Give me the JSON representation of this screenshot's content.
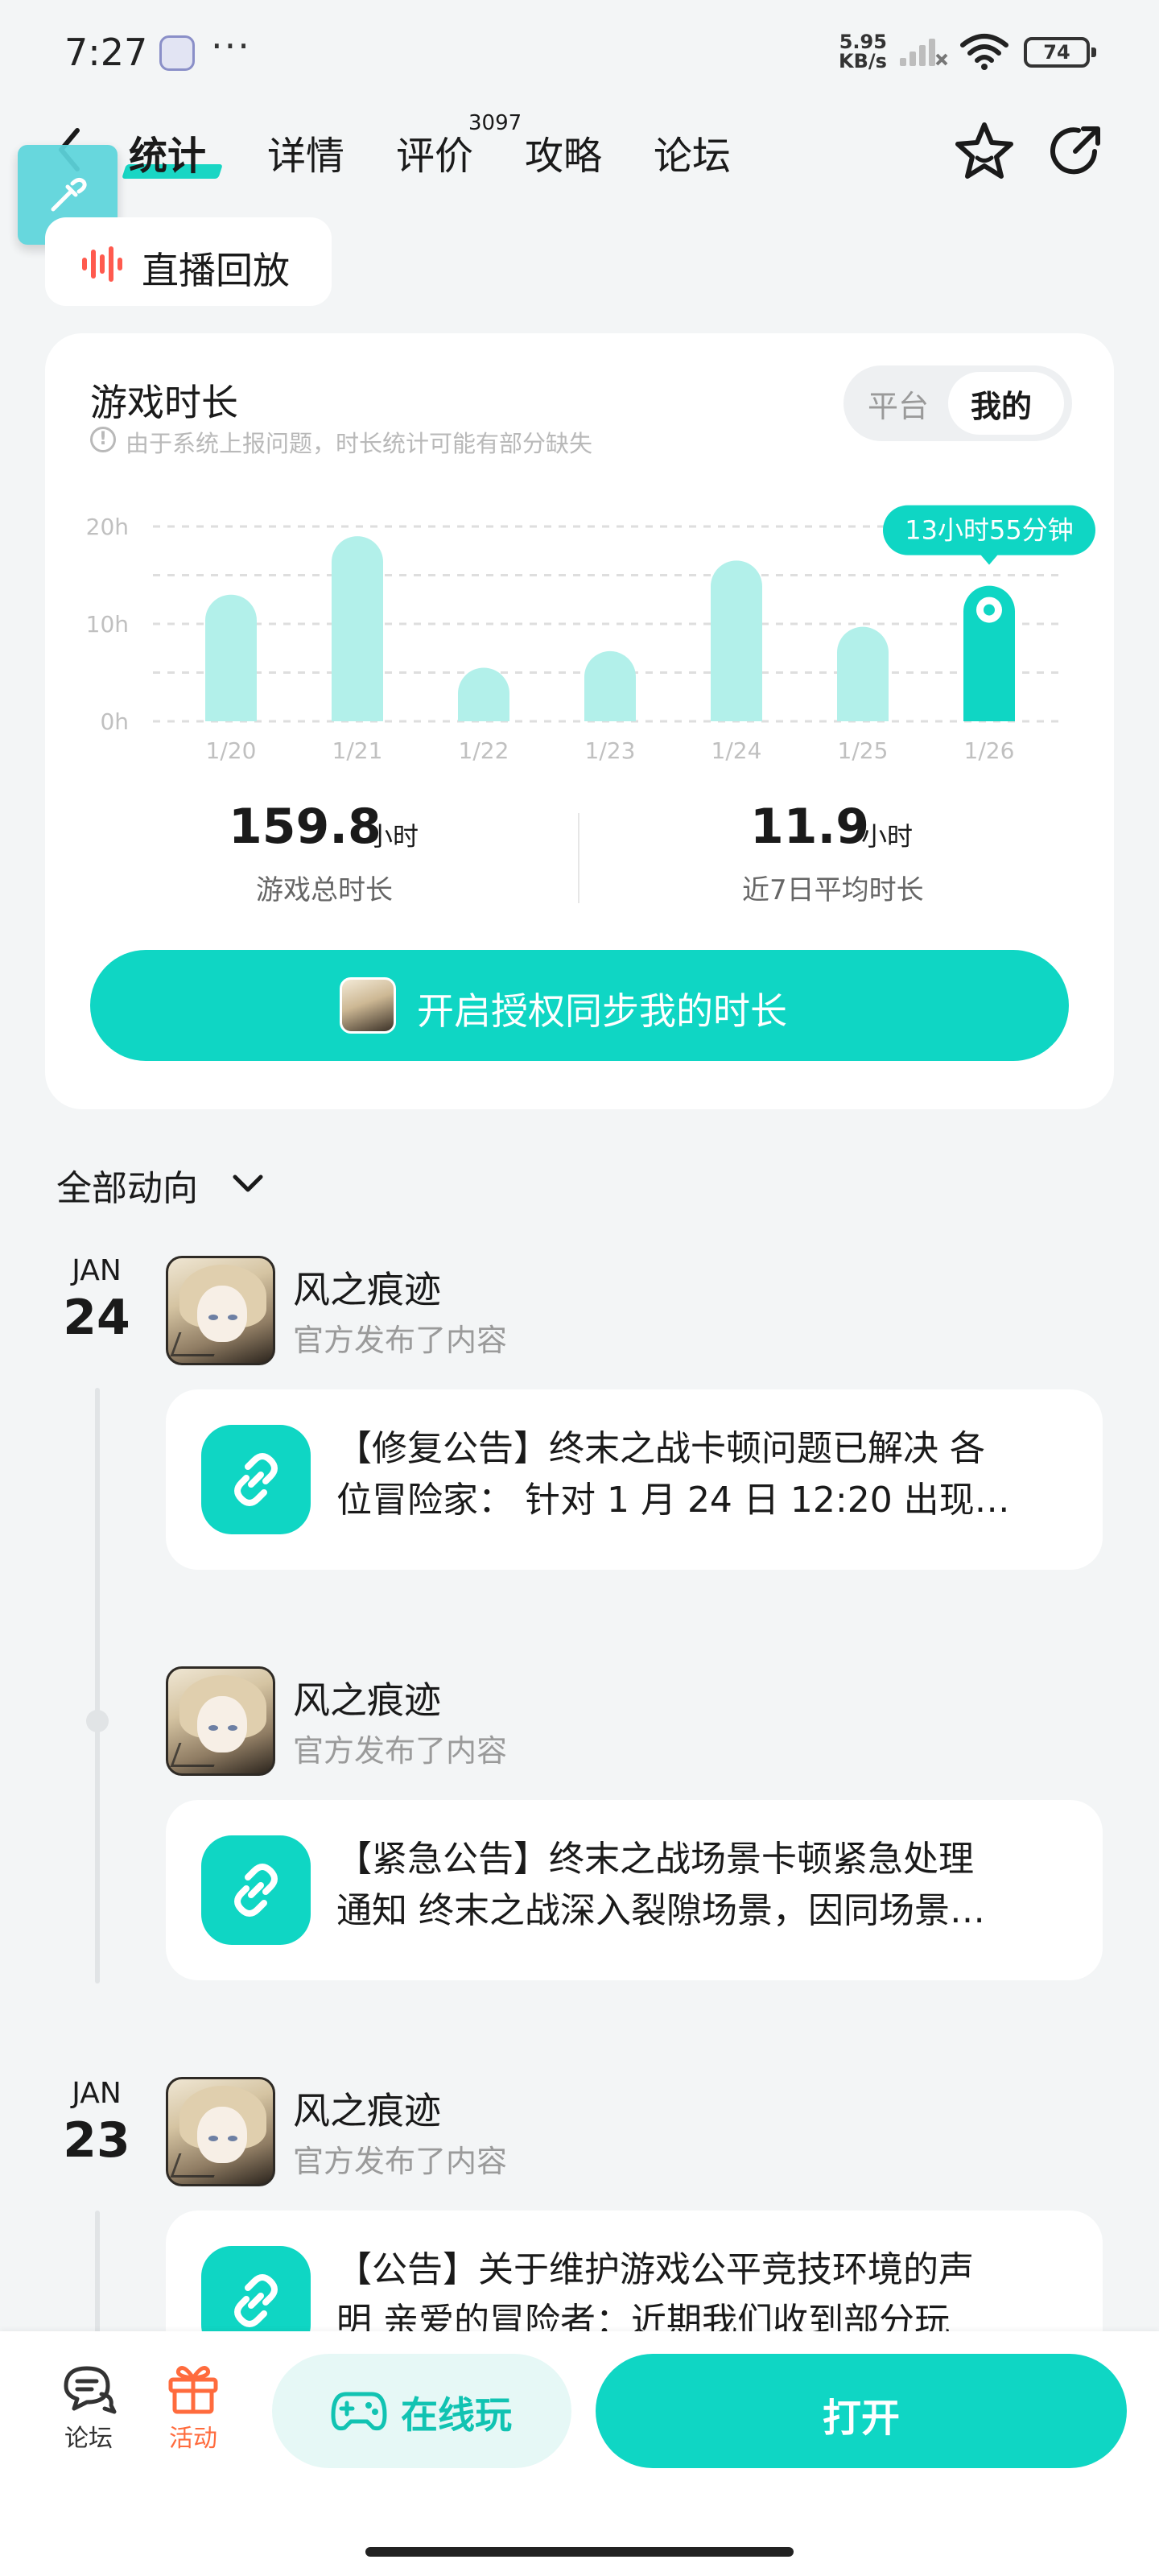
{
  "status_bar": {
    "time": "7:27",
    "net_speed_value": "5.95",
    "net_speed_unit": "KB/s",
    "battery": "74"
  },
  "nav": {
    "tabs": [
      "统计",
      "详情",
      "评价",
      "攻略",
      "论坛"
    ],
    "review_count": "3097"
  },
  "live_replay": {
    "label": "直播回放"
  },
  "playtime": {
    "title": "游戏时长",
    "note": "由于系统上报问题，时长统计可能有部分缺失",
    "toggle": {
      "platform": "平台",
      "mine": "我的"
    },
    "total_value": "159.8",
    "total_unit": "小时",
    "total_label": "游戏总时长",
    "avg_value": "11.9",
    "avg_unit": "小时",
    "avg_label": "近7日平均时长",
    "sync_button": "开启授权同步我的时长"
  },
  "chart_data": {
    "type": "bar",
    "categories": [
      "1/20",
      "1/21",
      "1/22",
      "1/23",
      "1/24",
      "1/25",
      "1/26"
    ],
    "values": [
      13,
      19,
      5.5,
      7.2,
      16.5,
      9.7,
      13.92
    ],
    "y_ticks": [
      "0h",
      "10h",
      "20h"
    ],
    "ylim": [
      0,
      20
    ],
    "highlight_index": 6,
    "highlight_label": "13小时55分钟",
    "grid": true,
    "colors": {
      "bar": "#b2f0ea",
      "highlight": "#0fd6c4",
      "grid": "#dedede",
      "axis_text": "#c0c0c0"
    }
  },
  "feed": {
    "filter_label": "全部动向",
    "groups": [
      {
        "month": "JAN",
        "day": "24",
        "posts": [
          {
            "author": "风之痕迹",
            "sub": "官方发布了内容",
            "lines": [
              "【修复公告】终末之战卡顿问题已解决 各",
              "位冒险家： 针对 1 月 24 日 12:20 出现…"
            ]
          },
          {
            "author": "风之痕迹",
            "sub": "官方发布了内容",
            "lines": [
              "【紧急公告】终末之战场景卡顿紧急处理",
              "通知 终末之战深入裂隙场景，因同场景…"
            ]
          }
        ]
      },
      {
        "month": "JAN",
        "day": "23",
        "posts": [
          {
            "author": "风之痕迹",
            "sub": "官方发布了内容",
            "lines": [
              "【公告】关于维护游戏公平竞技环境的声",
              "明 亲爱的冒险者：近期我们收到部分玩"
            ]
          }
        ]
      }
    ]
  },
  "bottom_bar": {
    "forum": "论坛",
    "activity": "活动",
    "play_online": "在线玩",
    "open": "打开"
  },
  "icons": [
    "back-icon",
    "favorite-icon",
    "share-icon",
    "eyedropper-icon",
    "wave-icon",
    "info-icon",
    "chevron-down-icon",
    "link-icon",
    "forum-icon",
    "gift-icon",
    "gamepad-icon",
    "wifi-icon",
    "signal-icon",
    "battery-icon"
  ]
}
